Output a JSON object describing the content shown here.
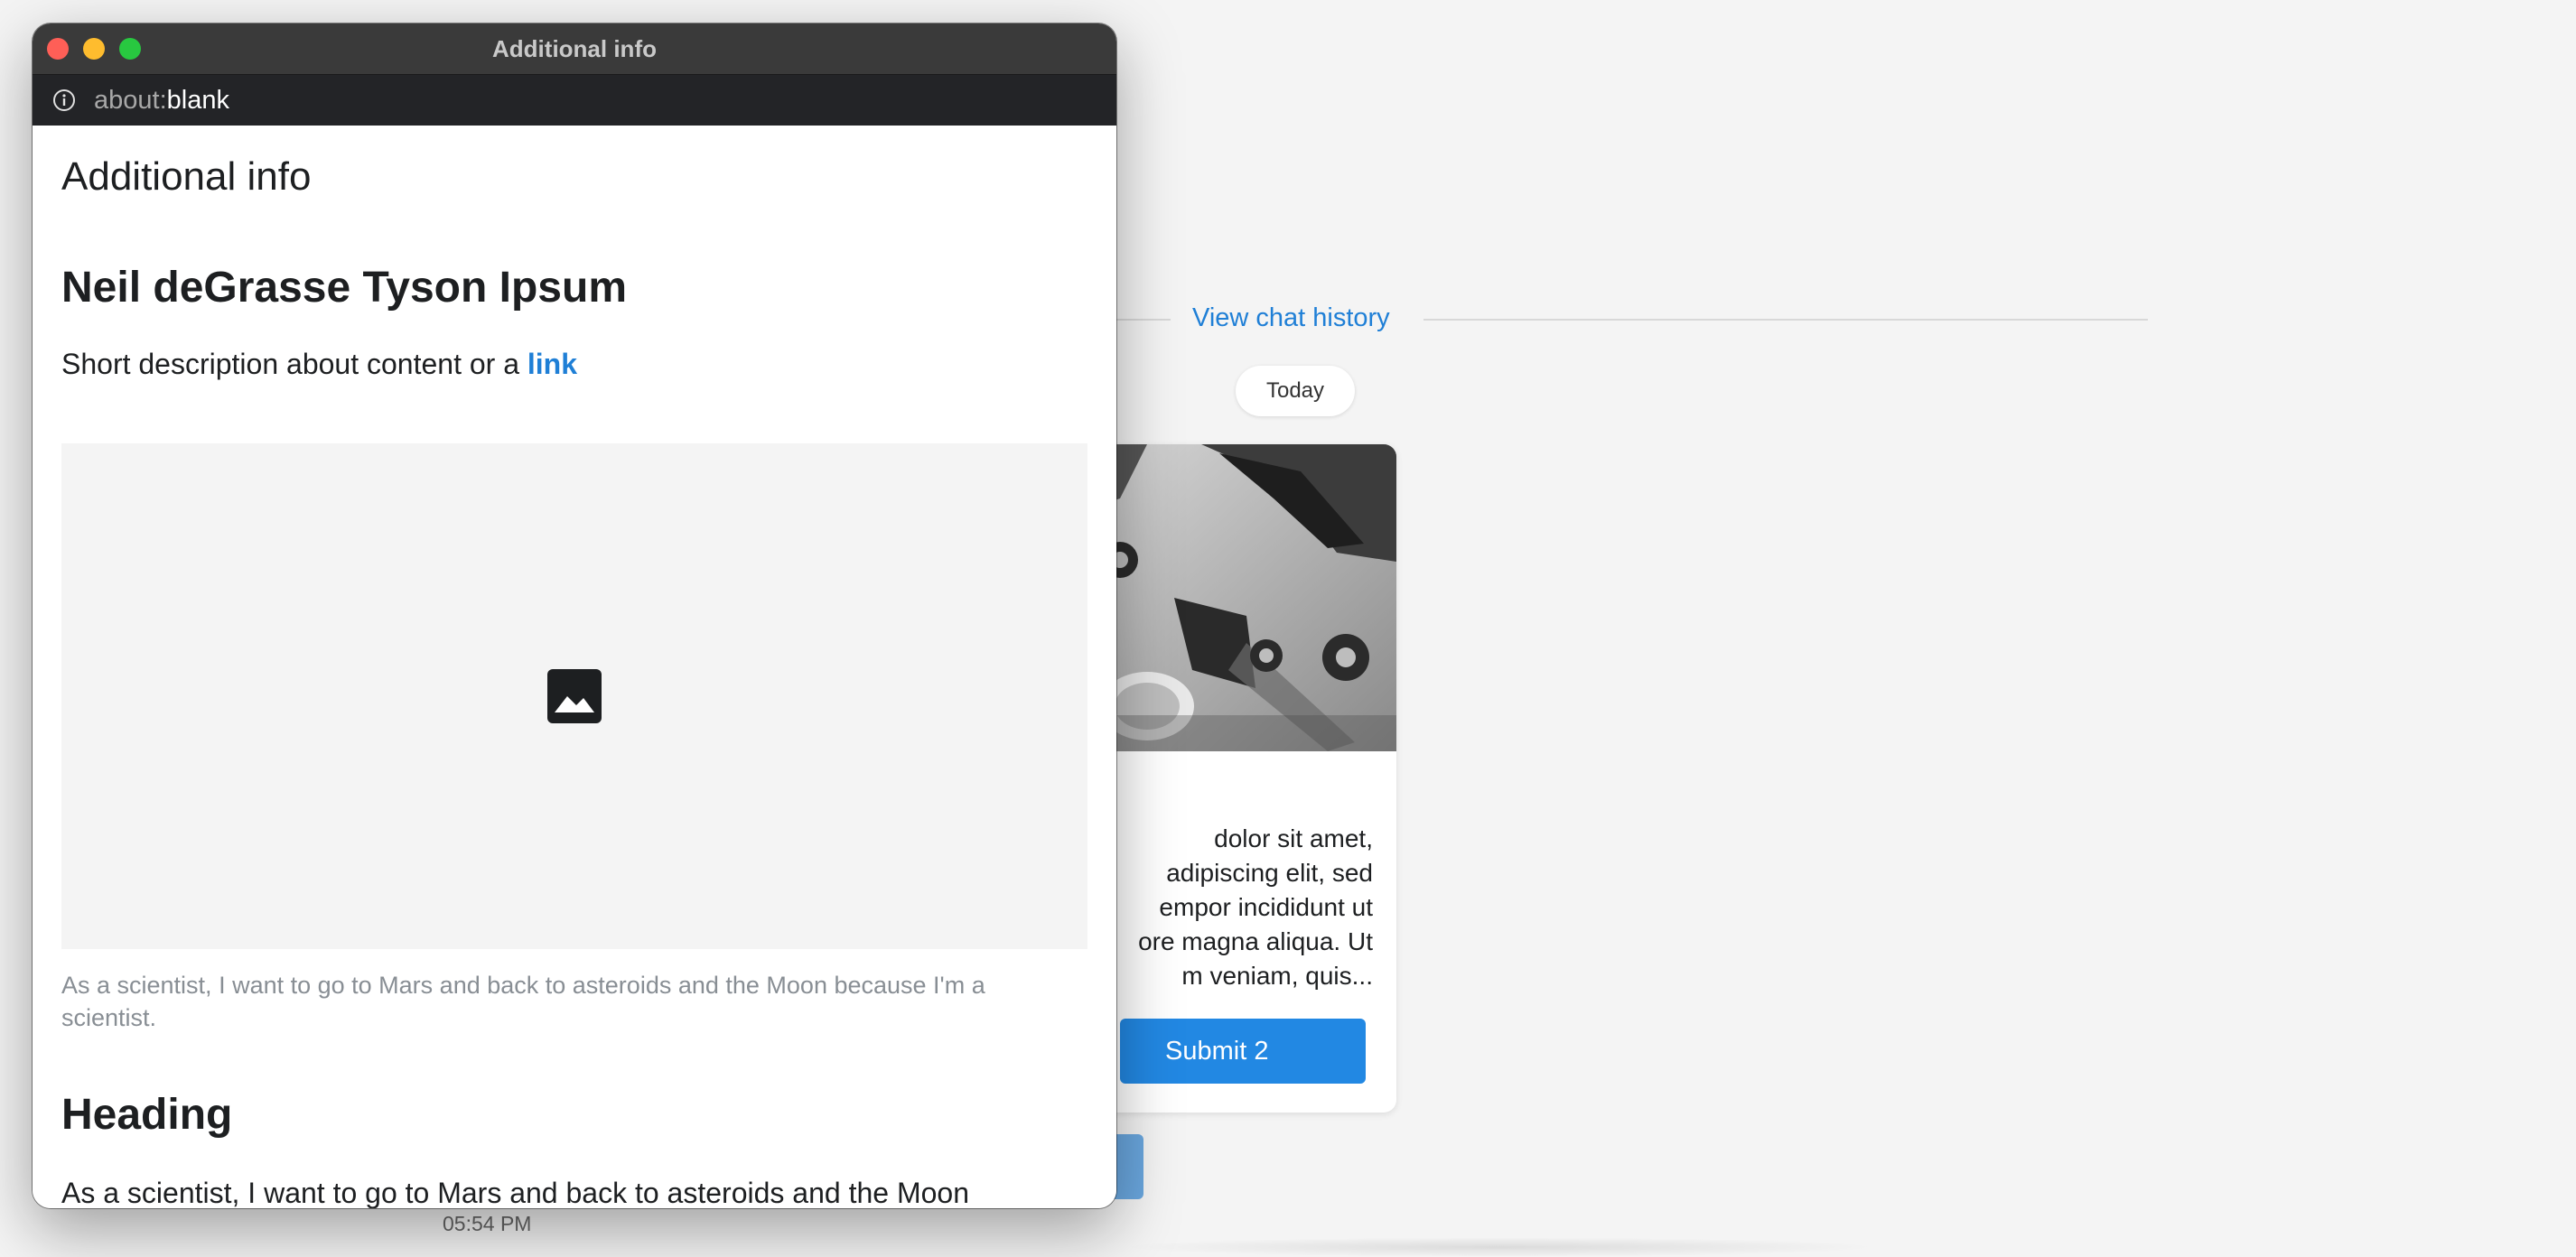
{
  "chat": {
    "view_history_label": "View chat history",
    "date_pill": "Today",
    "card_text": "dolor sit amet,\nadipiscing elit, sed\nempor incididunt ut\nore magna aliqua. Ut\nm veniam, quis...",
    "card_button_label": "Submit 2",
    "timestamp": "05:54 PM"
  },
  "window": {
    "title": "Additional info",
    "url_scheme": "about:",
    "url_host": "blank"
  },
  "page": {
    "title": "Additional info",
    "heading": "Neil deGrasse Tyson Ipsum",
    "description": "Short description about content or a ",
    "description_link": "link",
    "image_icon": "image-icon",
    "caption": "As a scientist, I want to go to Mars and back to asteroids and the Moon because I'm a scientist.",
    "heading2": "Heading",
    "body": "As a scientist, I want to go to Mars and back to asteroids and the Moon"
  },
  "colors": {
    "accent": "#2288e3",
    "link": "#1f7fd6"
  }
}
